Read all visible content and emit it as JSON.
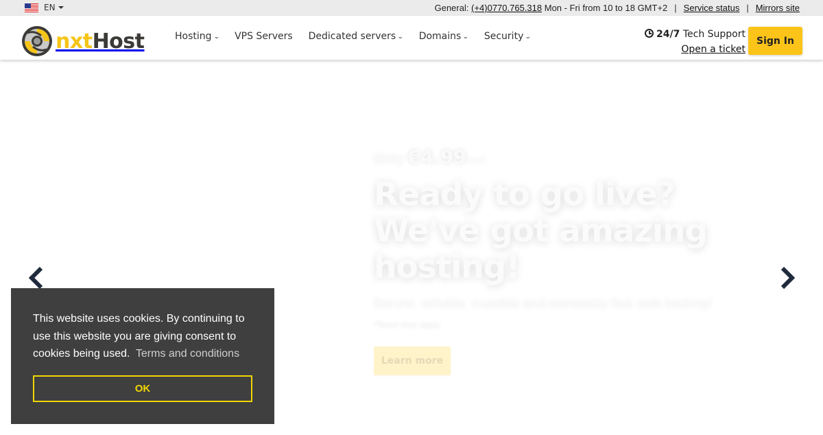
{
  "topbar": {
    "language": "EN",
    "flag_icon": "us-flag-icon",
    "general_label": "General:",
    "phone": "(+4)0770.765.318",
    "hours": "Mon - Fri from 10 to 18 GMT+2",
    "separator": "|",
    "service_status": "Service status",
    "mirrors_site": "Mirrors site"
  },
  "header": {
    "logo": {
      "part1": "nxt",
      "part2": "Host"
    },
    "nav": [
      {
        "label": "Hosting",
        "dropdown": true
      },
      {
        "label": "VPS Servers",
        "dropdown": false
      },
      {
        "label": "Dedicated servers",
        "dropdown": true
      },
      {
        "label": "Domains",
        "dropdown": true
      },
      {
        "label": "Security",
        "dropdown": true
      }
    ],
    "support": {
      "hours_bold": "24/7",
      "label": "Tech Support",
      "ticket_link": "Open a ticket"
    },
    "signin_label": "Sign In"
  },
  "hero": {
    "price_prefix": "Only",
    "price": "€4.99",
    "price_suffix": "/mo*",
    "headline_lines": [
      "Ready to go live?",
      "We've got amazing",
      "hosting!"
    ],
    "subtitle": "Secure, reliable, scalable and extremely fast web hosting!",
    "note": "*Taxes may apply.",
    "cta": "Learn more",
    "prev_icon": "chevron-left-icon",
    "next_icon": "chevron-right-icon"
  },
  "cookie_banner": {
    "message": "This website uses cookies. By continuing to use this website you are giving consent to cookies being used.",
    "link": "Terms and conditions",
    "ok_label": "OK"
  },
  "colors": {
    "brand_yellow": "#fcc419",
    "logo_dark": "#3b3a37",
    "cookie_bg": "#3f3f3f",
    "cookie_accent": "#f1d600",
    "arrow": "#1f2a3c",
    "topbar_bg": "#ebebeb"
  }
}
